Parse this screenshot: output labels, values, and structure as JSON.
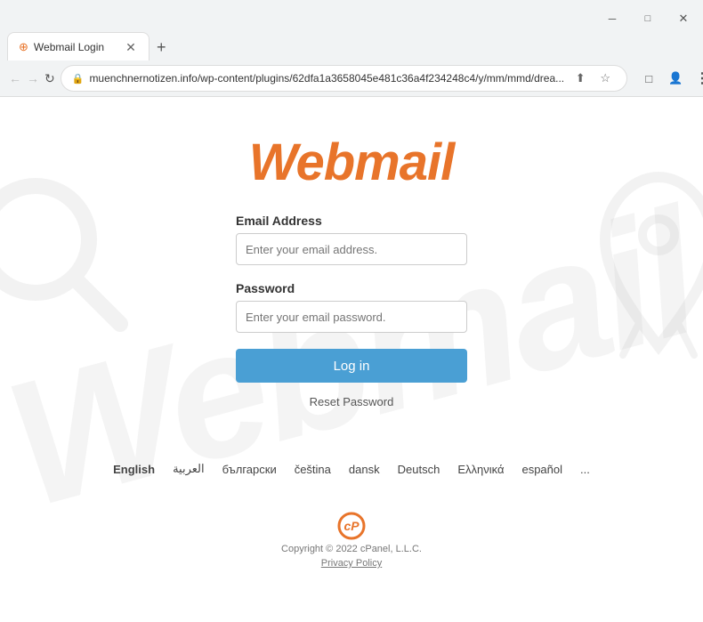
{
  "browser": {
    "tab_title": "Webmail Login",
    "tab_icon": "⊕",
    "url": "muenchnernotizen.info/wp-content/plugins/62dfa1a3658045e481c36a4f234248c4/y/mm/mmd/drea...",
    "new_tab_label": "+",
    "back_label": "←",
    "forward_label": "→",
    "reload_label": "↻",
    "menu_label": "⋮"
  },
  "page": {
    "logo_text": "Webmail",
    "email_label": "Email Address",
    "email_placeholder": "Enter your email address.",
    "password_label": "Password",
    "password_placeholder": "Enter your email password.",
    "login_button": "Log in",
    "reset_link": "Reset Password"
  },
  "languages": [
    {
      "code": "en",
      "label": "English",
      "active": true
    },
    {
      "code": "ar",
      "label": "العربية"
    },
    {
      "code": "bg",
      "label": "български"
    },
    {
      "code": "cs",
      "label": "čeština"
    },
    {
      "code": "da",
      "label": "dansk"
    },
    {
      "code": "de",
      "label": "Deutsch"
    },
    {
      "code": "el",
      "label": "Ελληνικά"
    },
    {
      "code": "es",
      "label": "español"
    },
    {
      "code": "more",
      "label": "..."
    }
  ],
  "footer": {
    "copyright": "Copyright © 2022 cPanel, L.L.C.",
    "privacy_link": "Privacy Policy"
  },
  "colors": {
    "orange": "#e8742a",
    "blue": "#4a9fd4",
    "cpanel_orange": "#e8742a"
  }
}
